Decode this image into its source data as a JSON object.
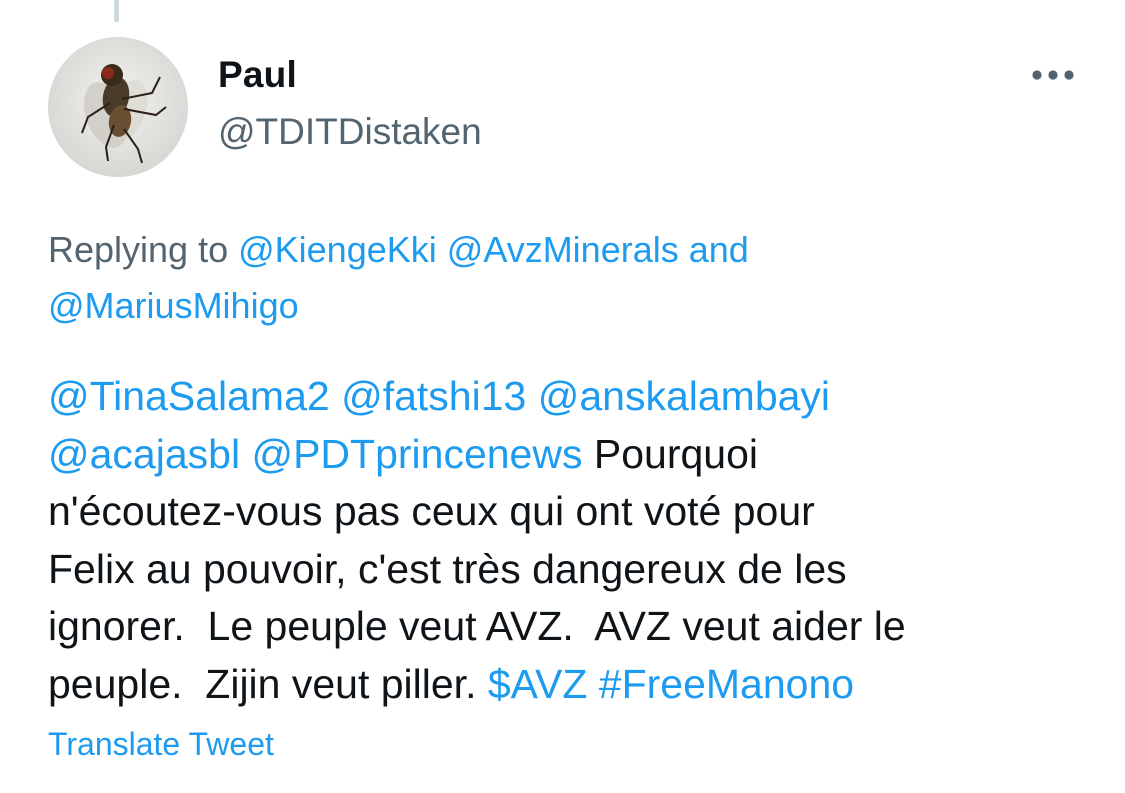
{
  "tweet": {
    "author": {
      "display_name": "Paul",
      "handle": "@TDITDistaken",
      "avatar_icon": "fly-photo-avatar"
    },
    "more_icon": "ellipsis-icon",
    "replying": {
      "prefix": "Replying to ",
      "mention_1": "@KiengeKki",
      "mention_2": "@AvzMinerals",
      "conjunction": " and",
      "mention_3": "@MariusMihigo"
    },
    "body": {
      "mentions": [
        "@TinaSalama2",
        "@fatshi13",
        "@anskalambayi",
        "@acajasbl",
        "@PDTprincenews"
      ],
      "text_1": "Pourquoi\nn'écoutez-vous pas ceux qui ont voté pour\nFelix au pouvoir, c'est très dangereux de les\nignorer.  Le peuple veut AVZ.  AVZ veut aider le\npeuple.  Zijin veut piller.",
      "cashtag": "$AVZ",
      "hashtag": "#FreeManono"
    },
    "translate_label": "Translate Tweet"
  },
  "colors": {
    "link": "#1d9bf0",
    "secondary_text": "#536471",
    "primary_text": "#0f1419",
    "thread_line": "#cfd9de"
  }
}
